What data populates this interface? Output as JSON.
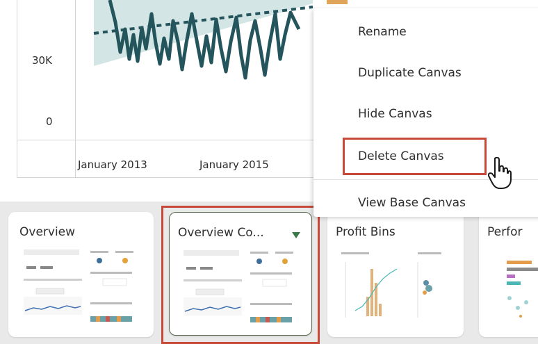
{
  "chart": {
    "y_ticks": [
      "30K",
      "0"
    ],
    "x_ticks": [
      "January 2013",
      "January 2015"
    ]
  },
  "context_menu": {
    "items": [
      {
        "label": "Rename"
      },
      {
        "label": "Duplicate Canvas"
      },
      {
        "label": "Hide Canvas"
      },
      {
        "label": "Delete Canvas"
      },
      {
        "label": "View Base Canvas"
      }
    ]
  },
  "canvas_tabs": [
    {
      "title": "Overview"
    },
    {
      "title": "Overview Co..."
    },
    {
      "title": "Profit Bins"
    },
    {
      "title": "Perfor"
    }
  ],
  "colors": {
    "series_line": "#24555c",
    "band": "#d3e6e5",
    "highlight": "#c7493a",
    "active_tab_border": "#5a6b4d",
    "dropdown_caret": "#3c7a4a"
  }
}
